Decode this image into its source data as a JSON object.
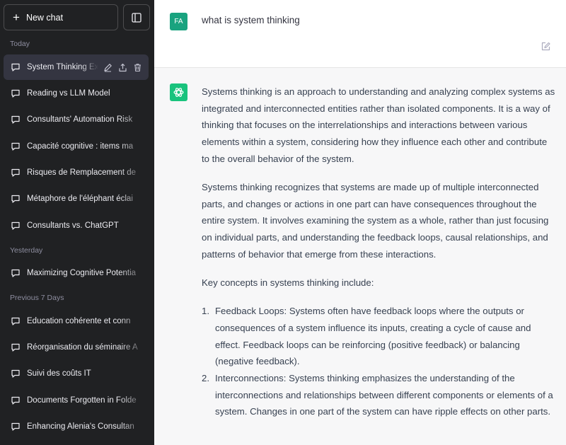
{
  "sidebar": {
    "new_chat_label": "New chat",
    "sections": {
      "today": "Today",
      "yesterday": "Yesterday",
      "previous_7_days": "Previous 7 Days"
    },
    "items": [
      {
        "label": "System Thinking Ex",
        "active": true
      },
      {
        "label": "Reading vs LLM Model"
      },
      {
        "label": "Consultants' Automation Risk"
      },
      {
        "label": "Capacité cognitive : items ma"
      },
      {
        "label": "Risques de Remplacement de"
      },
      {
        "label": "Métaphore de l'éléphant éclai"
      },
      {
        "label": "Consultants vs. ChatGPT"
      },
      {
        "label": "Maximizing Cognitive Potentia"
      },
      {
        "label": "Éducation cohérente et conn"
      },
      {
        "label": "Réorganisation du séminaire A"
      },
      {
        "label": "Suivi des coûts IT"
      },
      {
        "label": "Documents Forgotten in Folde"
      },
      {
        "label": "Enhancing Alenia's Consultan"
      }
    ]
  },
  "conversation": {
    "user_initials": "FA",
    "user_message": "what is system thinking",
    "assistant": {
      "paragraphs": [
        "Systems thinking is an approach to understanding and analyzing complex systems as integrated and interconnected entities rather than isolated components. It is a way of thinking that focuses on the interrelationships and interactions between various elements within a system, considering how they influence each other and contribute to the overall behavior of the system.",
        "Systems thinking recognizes that systems are made up of multiple interconnected parts, and changes or actions in one part can have consequences throughout the entire system. It involves examining the system as a whole, rather than just focusing on individual parts, and understanding the feedback loops, causal relationships, and patterns of behavior that emerge from these interactions.",
        "Key concepts in systems thinking include:"
      ],
      "list": [
        {
          "num": "1.",
          "text": "Feedback Loops: Systems often have feedback loops where the outputs or consequences of a system influence its inputs, creating a cycle of cause and effect. Feedback loops can be reinforcing (positive feedback) or balancing (negative feedback)."
        },
        {
          "num": "2.",
          "text": "Interconnections: Systems thinking emphasizes the understanding of the interconnections and relationships between different components or elements of a system. Changes in one part of the system can have ripple effects on other parts."
        }
      ]
    }
  },
  "colors": {
    "sidebar_bg": "#202123",
    "user_avatar": "#19a37f",
    "assistant_avatar": "#19c37d",
    "main_bg": "#f7f7f8"
  },
  "icons": [
    "plus-icon",
    "sidebar-toggle-icon",
    "chat-bubble-icon",
    "pencil-icon",
    "share-icon",
    "trash-icon",
    "edit-icon",
    "openai-logo-icon"
  ]
}
